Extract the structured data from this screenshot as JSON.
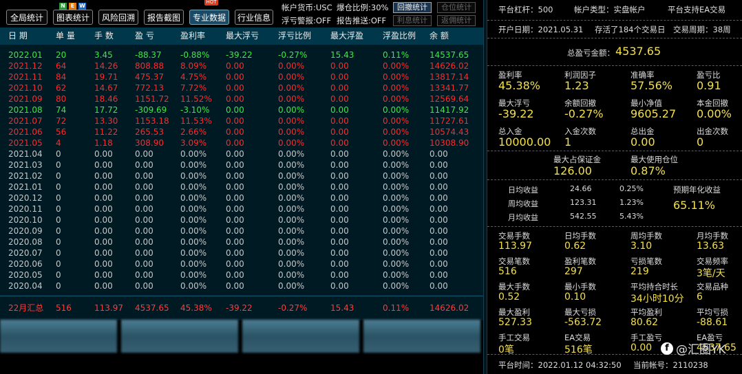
{
  "toolbar": {
    "buttons": [
      {
        "label": "全局统计",
        "active": false
      },
      {
        "label": "图表统计",
        "active": false
      },
      {
        "label": "风险回溯",
        "active": false
      },
      {
        "label": "报告截图",
        "active": false
      },
      {
        "label": "专业数据",
        "active": true
      },
      {
        "label": "行业信息",
        "active": false
      }
    ],
    "new_tag": [
      "N",
      "E",
      "W"
    ],
    "hot_tag": "HOT",
    "account_currency": "帐户货币:USC",
    "blowup_ratio": "爆仓比例:30%",
    "float_warning": "浮亏警报:OFF",
    "report_push": "报告推送:OFF",
    "toggles": [
      {
        "label": "回撤统计",
        "on": true
      },
      {
        "label": "仓位统计",
        "on": false
      },
      {
        "label": "利息统计",
        "on": false
      },
      {
        "label": "返佣统计",
        "on": false
      }
    ]
  },
  "table": {
    "headers": [
      "日 期",
      "单 量",
      "手 数",
      "盈 亏",
      "盈利率",
      "最大浮亏",
      "浮亏比例",
      "最大浮盈",
      "浮盈比例",
      "余 额"
    ],
    "rows": [
      {
        "c": "green",
        "v": [
          "2022.01",
          "20",
          "3.45",
          "-88.37",
          "-0.88%",
          "-39.22",
          "-0.27%",
          "15.43",
          "0.11%",
          "14537.65"
        ]
      },
      {
        "c": "red",
        "v": [
          "2021.12",
          "64",
          "14.26",
          "808.88",
          "8.09%",
          "0.00",
          "0.00%",
          "0.00",
          "0.00%",
          "14626.02"
        ]
      },
      {
        "c": "red",
        "v": [
          "2021.11",
          "84",
          "19.71",
          "475.37",
          "4.75%",
          "0.00",
          "0.00%",
          "0.00",
          "0.00%",
          "13817.14"
        ]
      },
      {
        "c": "red",
        "v": [
          "2021.10",
          "62",
          "14.67",
          "772.13",
          "7.72%",
          "0.00",
          "0.00%",
          "0.00",
          "0.00%",
          "13341.77"
        ]
      },
      {
        "c": "red",
        "v": [
          "2021.09",
          "80",
          "18.46",
          "1151.72",
          "11.52%",
          "0.00",
          "0.00%",
          "0.00",
          "0.00%",
          "12569.64"
        ]
      },
      {
        "c": "green",
        "v": [
          "2021.08",
          "74",
          "17.72",
          "-309.69",
          "-3.10%",
          "0.00",
          "0.00%",
          "0.00",
          "0.00%",
          "11417.92"
        ]
      },
      {
        "c": "red",
        "v": [
          "2021.07",
          "72",
          "13.30",
          "1153.18",
          "11.53%",
          "0.00",
          "0.00%",
          "0.00",
          "0.00%",
          "11727.61"
        ]
      },
      {
        "c": "red",
        "v": [
          "2021.06",
          "56",
          "11.22",
          "265.53",
          "2.66%",
          "0.00",
          "0.00%",
          "0.00",
          "0.00%",
          "10574.43"
        ]
      },
      {
        "c": "red",
        "v": [
          "2021.05",
          "4",
          "1.18",
          "308.90",
          "3.09%",
          "0.00",
          "0.00%",
          "0.00",
          "0.00%",
          "10308.90"
        ]
      },
      {
        "c": "gray",
        "v": [
          "2021.04",
          "0",
          "0.00",
          "0.00",
          "0.00%",
          "0.00",
          "0.00%",
          "0.00",
          "0.00%",
          "0.00"
        ]
      },
      {
        "c": "gray",
        "v": [
          "2021.03",
          "0",
          "0.00",
          "0.00",
          "0.00%",
          "0.00",
          "0.00%",
          "0.00",
          "0.00%",
          "0.00"
        ]
      },
      {
        "c": "gray",
        "v": [
          "2021.02",
          "0",
          "0.00",
          "0.00",
          "0.00%",
          "0.00",
          "0.00%",
          "0.00",
          "0.00%",
          "0.00"
        ]
      },
      {
        "c": "gray",
        "v": [
          "2021.01",
          "0",
          "0.00",
          "0.00",
          "0.00%",
          "0.00",
          "0.00%",
          "0.00",
          "0.00%",
          "0.00"
        ]
      },
      {
        "c": "gray",
        "v": [
          "2020.12",
          "0",
          "0.00",
          "0.00",
          "0.00%",
          "0.00",
          "0.00%",
          "0.00",
          "0.00%",
          "0.00"
        ]
      },
      {
        "c": "gray",
        "v": [
          "2020.11",
          "0",
          "0.00",
          "0.00",
          "0.00%",
          "0.00",
          "0.00%",
          "0.00",
          "0.00%",
          "0.00"
        ]
      },
      {
        "c": "gray",
        "v": [
          "2020.10",
          "0",
          "0.00",
          "0.00",
          "0.00%",
          "0.00",
          "0.00%",
          "0.00",
          "0.00%",
          "0.00"
        ]
      },
      {
        "c": "gray",
        "v": [
          "2020.09",
          "0",
          "0.00",
          "0.00",
          "0.00%",
          "0.00",
          "0.00%",
          "0.00",
          "0.00%",
          "0.00"
        ]
      },
      {
        "c": "gray",
        "v": [
          "2020.08",
          "0",
          "0.00",
          "0.00",
          "0.00%",
          "0.00",
          "0.00%",
          "0.00",
          "0.00%",
          "0.00"
        ]
      },
      {
        "c": "gray",
        "v": [
          "2020.07",
          "0",
          "0.00",
          "0.00",
          "0.00%",
          "0.00",
          "0.00%",
          "0.00",
          "0.00%",
          "0.00"
        ]
      },
      {
        "c": "gray",
        "v": [
          "2020.06",
          "0",
          "0.00",
          "0.00",
          "0.00%",
          "0.00",
          "0.00%",
          "0.00",
          "0.00%",
          "0.00"
        ]
      },
      {
        "c": "gray",
        "v": [
          "2020.05",
          "0",
          "0.00",
          "0.00",
          "0.00%",
          "0.00",
          "0.00%",
          "0.00",
          "0.00%",
          "0.00"
        ]
      },
      {
        "c": "gray",
        "v": [
          "2020.04",
          "0",
          "0.00",
          "0.00",
          "0.00%",
          "0.00",
          "0.00%",
          "0.00",
          "0.00%",
          "0.00"
        ]
      }
    ],
    "summary": [
      "22月汇总",
      "516",
      "113.97",
      "4537.65",
      "45.38%",
      "-39.22",
      "-0.27%",
      "15.43",
      "0.11%",
      "14626.02"
    ]
  },
  "colors": {
    "red": "#ff2a2a",
    "green": "#3ee83e",
    "gray": "#c8c8c8",
    "yellow": "#f4e04a",
    "summary": "#ff3b3b"
  },
  "right": {
    "platform_leverage": "平台杠杆：500",
    "account_type": "帐户类型：实盘帐户",
    "ea_support": "平台支持EA交易",
    "open_date": "开户日期：2021.05.31",
    "days_active": "存活了184个交易日",
    "trade_cycle": "交易周期：38周",
    "total_pnl_label": "总盈亏金额：",
    "total_pnl_value": "4537.65",
    "stats": [
      [
        {
          "l": "盈利率",
          "v": "45.38%"
        },
        {
          "l": "利润因子",
          "v": "1.23"
        },
        {
          "l": "准确率",
          "v": "57.56%"
        },
        {
          "l": "盈亏比",
          "v": "0.91"
        }
      ],
      [
        {
          "l": "最大浮亏",
          "v": "-39.22"
        },
        {
          "l": "余额回撤",
          "v": "-0.27%"
        },
        {
          "l": "最小净值",
          "v": "9605.27"
        },
        {
          "l": "本金回撤",
          "v": "0.00%"
        }
      ],
      [
        {
          "l": "总入金",
          "v": "10000.00"
        },
        {
          "l": "入金次数",
          "v": "1"
        },
        {
          "l": "总出金",
          "v": "0.00"
        },
        {
          "l": "出金次数",
          "v": "0"
        }
      ]
    ],
    "margin": [
      {
        "l": "最大占保证金",
        "v": "126.00"
      },
      {
        "l": "最大使用仓位",
        "v": "0.87%"
      }
    ],
    "returns": [
      {
        "l": "日均收益",
        "a": "24.66",
        "p": "0.25%"
      },
      {
        "l": "周均收益",
        "a": "123.31",
        "p": "1.23%"
      },
      {
        "l": "月均收益",
        "a": "542.55",
        "p": "5.43%"
      }
    ],
    "annual_label": "预期年化收益",
    "annual_value": "65.11%",
    "stats2": [
      [
        {
          "l": "交易手数",
          "v": "113.97"
        },
        {
          "l": "日均手数",
          "v": "0.62"
        },
        {
          "l": "周均手数",
          "v": "3.10"
        },
        {
          "l": "月均手数",
          "v": "13.63"
        }
      ],
      [
        {
          "l": "交易笔数",
          "v": "516"
        },
        {
          "l": "盈利笔数",
          "v": "297"
        },
        {
          "l": "亏损笔数",
          "v": "219"
        },
        {
          "l": "交易频率",
          "v": "3笔/天"
        }
      ],
      [
        {
          "l": "最大手数",
          "v": "0.52"
        },
        {
          "l": "最小手数",
          "v": "0.10"
        },
        {
          "l": "平均持合时长",
          "v": "34小时10分"
        },
        {
          "l": "交易品种",
          "v": "6"
        }
      ],
      [
        {
          "l": "最大盈利",
          "v": "527.33"
        },
        {
          "l": "最大亏损",
          "v": "-563.72"
        },
        {
          "l": "平均盈利",
          "v": "80.62"
        },
        {
          "l": "平均亏损",
          "v": "-88.61"
        }
      ],
      [
        {
          "l": "手工交易",
          "v": "0笔"
        },
        {
          "l": "EA交易",
          "v": "516笔"
        },
        {
          "l": "手工盈亏",
          "v": "0.00"
        },
        {
          "l": "EA盈亏",
          "v": "4537.65"
        }
      ]
    ],
    "platform_time": "平台时间：2022.01.12 04:32:50",
    "account_no": "当前帐号：2110238"
  },
  "watermark": "@汇圈YK",
  "watermark_icon": "f"
}
